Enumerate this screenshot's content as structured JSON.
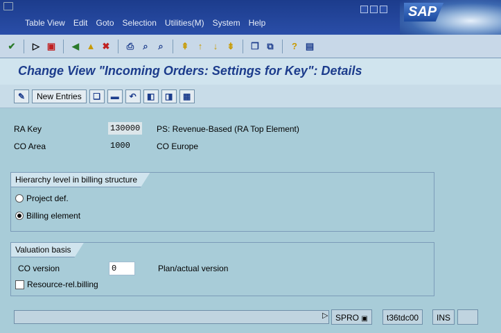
{
  "menu": [
    "Table View",
    "Edit",
    "Goto",
    "Selection",
    "Utilities(M)",
    "System",
    "Help"
  ],
  "logo": "SAP",
  "title": "Change View \"Incoming Orders: Settings for Key\": Details",
  "app_toolbar": {
    "new_entries": "New Entries"
  },
  "fields": {
    "ra_key": {
      "label": "RA Key",
      "value": "130000",
      "desc": "PS: Revenue-Based (RA Top Element)"
    },
    "co_area": {
      "label": "CO Area",
      "value": "1000",
      "desc": "CO Europe"
    }
  },
  "hierarchy_group": {
    "title": "Hierarchy level in billing structure",
    "options": [
      {
        "label": "Project def.",
        "selected": false
      },
      {
        "label": "Billing element",
        "selected": true
      }
    ]
  },
  "valuation_group": {
    "title": "Valuation basis",
    "co_version_label": "CO version",
    "co_version_value": "0",
    "co_version_desc": "Plan/actual version",
    "resource_billing_label": "Resource-rel.billing",
    "resource_billing_checked": false
  },
  "status": {
    "transaction": "SPRO",
    "server": "t36tdc00",
    "mode": "INS"
  }
}
